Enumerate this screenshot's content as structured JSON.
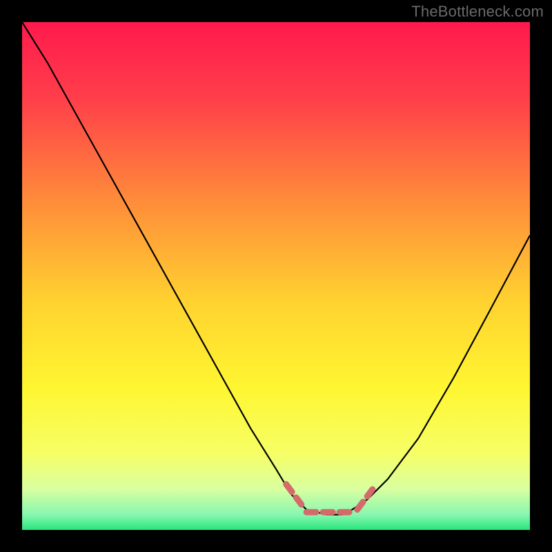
{
  "watermark": "TheBottleneck.com",
  "gradient": {
    "stops": [
      {
        "offset": 0.0,
        "color": "#ff1a4d"
      },
      {
        "offset": 0.15,
        "color": "#ff3e4a"
      },
      {
        "offset": 0.35,
        "color": "#ff8b3a"
      },
      {
        "offset": 0.55,
        "color": "#ffd230"
      },
      {
        "offset": 0.72,
        "color": "#fff631"
      },
      {
        "offset": 0.85,
        "color": "#f6ff66"
      },
      {
        "offset": 0.92,
        "color": "#d9ffa0"
      },
      {
        "offset": 0.97,
        "color": "#88f7b0"
      },
      {
        "offset": 1.0,
        "color": "#29e57d"
      }
    ]
  },
  "curve": {
    "stroke": "#000000",
    "strokeWidth": 2.2
  },
  "dashes": {
    "stroke": "#d46a6a",
    "strokeWidth": 9,
    "linecap": "round"
  },
  "chart_data": {
    "type": "line",
    "title": "",
    "xlabel": "",
    "ylabel": "",
    "xlim": [
      0,
      100
    ],
    "ylim": [
      0,
      100
    ],
    "note": "Values are read off the plot as percentages of the axis range (0–100). Lower y = better (bottom of plot). The curve forms a V with a flat minimum near x≈56–65 at y≈3, rising steeply on both sides.",
    "series": [
      {
        "name": "bottleneck-curve",
        "x": [
          0,
          5,
          10,
          15,
          20,
          25,
          30,
          35,
          40,
          45,
          50,
          53,
          56,
          60,
          63,
          65,
          68,
          72,
          78,
          85,
          92,
          100
        ],
        "y": [
          100,
          92,
          83,
          74,
          65,
          56,
          47,
          38,
          29,
          20,
          12,
          7,
          4,
          3,
          3,
          4,
          6,
          10,
          18,
          30,
          43,
          58
        ]
      }
    ],
    "flat_minimum_range_x": [
      53,
      68
    ],
    "flat_minimum_y": 3,
    "dash_markers": {
      "left": {
        "x": [
          52,
          55
        ],
        "y": [
          9,
          5
        ]
      },
      "flat": {
        "x": [
          56,
          65
        ],
        "y": [
          3.5,
          3.5
        ]
      },
      "right": {
        "x": [
          66,
          69
        ],
        "y": [
          4,
          8
        ]
      }
    }
  }
}
